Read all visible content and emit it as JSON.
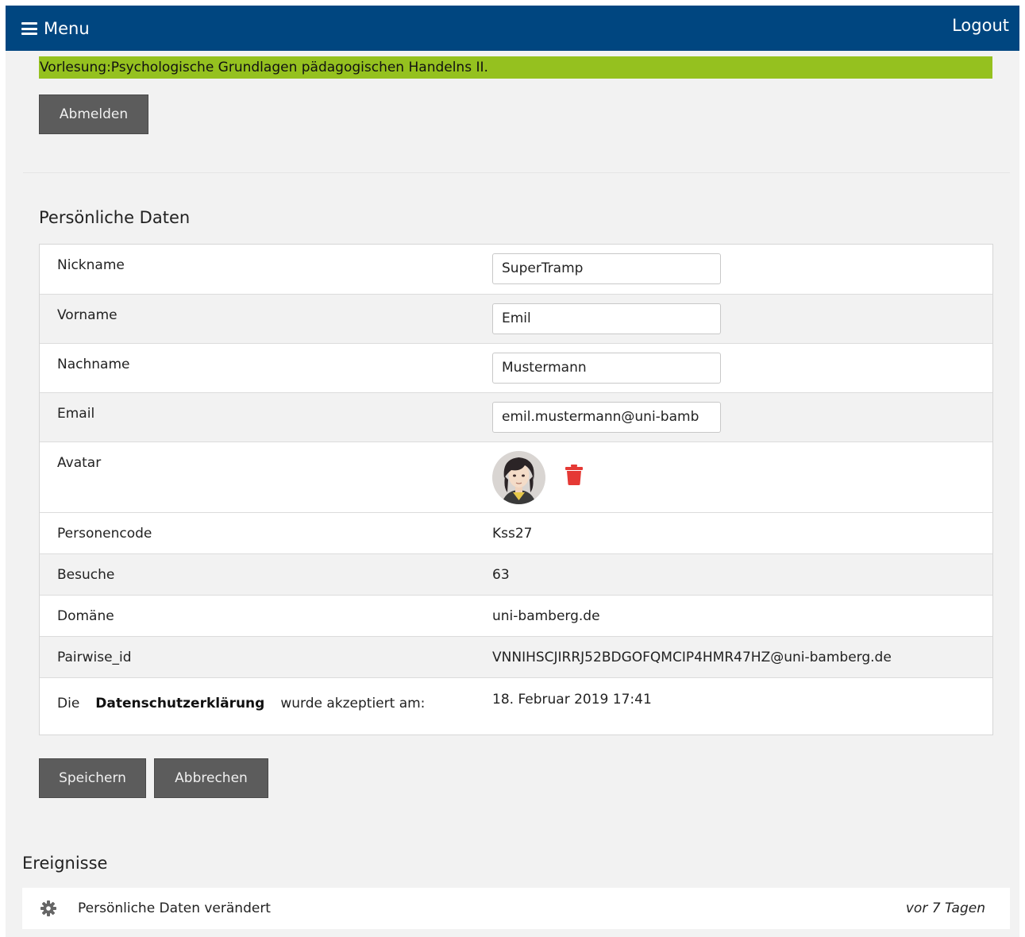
{
  "topbar": {
    "menu_label": "Menu",
    "logout_label": "Logout"
  },
  "lecture": {
    "banner": "Vorlesung:Psychologische Grundlagen pädagogischen Handelns II."
  },
  "actions": {
    "abmelden_label": "Abmelden",
    "save_label": "Speichern",
    "cancel_label": "Abbrechen"
  },
  "personal": {
    "title": "Persönliche Daten",
    "nickname": {
      "label": "Nickname",
      "value": "SuperTramp"
    },
    "vorname": {
      "label": "Vorname",
      "value": "Emil"
    },
    "nachname": {
      "label": "Nachname",
      "value": "Mustermann"
    },
    "email": {
      "label": "Email",
      "value": "emil.mustermann@uni-bamb"
    },
    "avatar": {
      "label": "Avatar"
    },
    "personencode": {
      "label": "Personencode",
      "value": "Kss27"
    },
    "besuche": {
      "label": "Besuche",
      "value": "63"
    },
    "domaene": {
      "label": "Domäne",
      "value": "uni-bamberg.de"
    },
    "pairwise": {
      "label": "Pairwise_id",
      "value": "VNNIHSCJIRRJ52BDGOFQMCIP4HMR47HZ@uni-bamberg.de"
    },
    "privacy": {
      "prefix": "Die",
      "link": "Datenschutzerklärung",
      "suffix": "wurde akzeptiert am:",
      "date": "18. Februar 2019 17:41"
    }
  },
  "events": {
    "title": "Ereignisse",
    "items": [
      {
        "icon": "gear-icon",
        "text": "Persönliche Daten verändert",
        "time": "vor 7 Tagen"
      }
    ]
  },
  "colors": {
    "topbar": "#004680",
    "banner": "#95c11f",
    "button": "#5c5c5c",
    "delete": "#e53935"
  }
}
